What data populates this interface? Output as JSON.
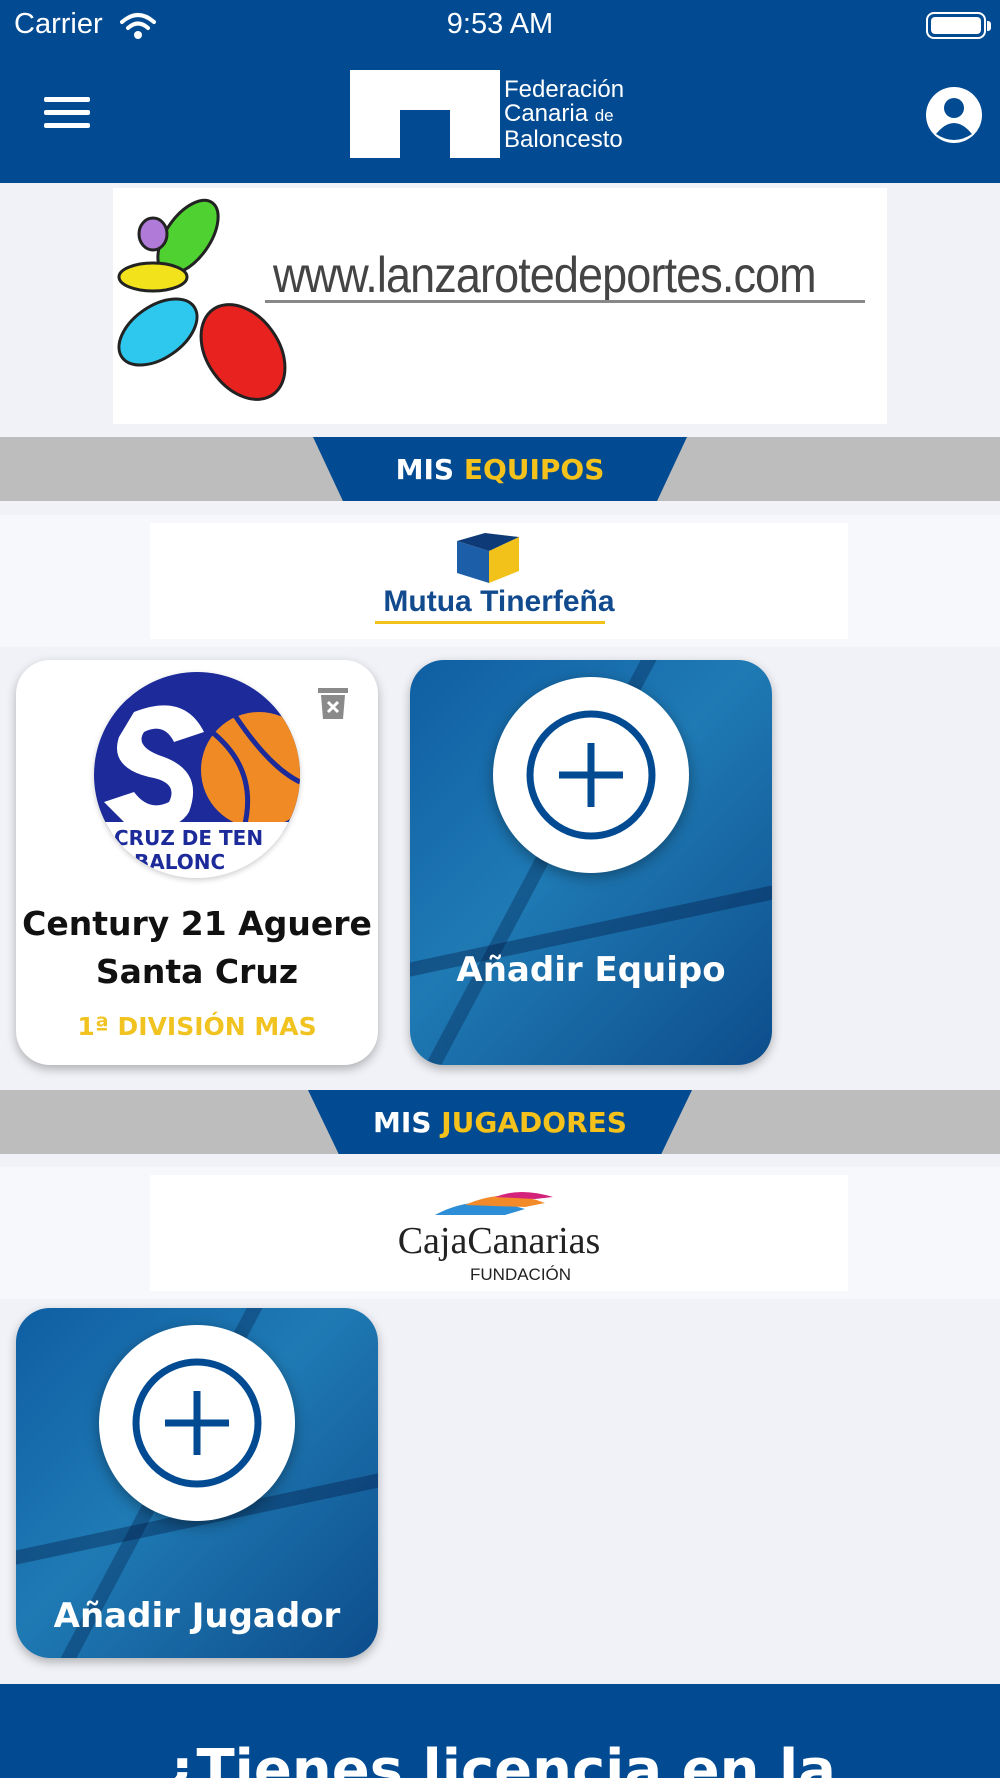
{
  "status": {
    "carrier": "Carrier",
    "time": "9:53 AM"
  },
  "header": {
    "logo_line1": "Federación",
    "logo_line2": "Canaria",
    "logo_line2_small": "de",
    "logo_line3": "Baloncesto"
  },
  "ads": {
    "top_url": "www.lanzarotedeportes.com",
    "sponsor1": "Mutua Tinerfeña",
    "sponsor2_line1": "CajaCanarias",
    "sponsor2_line2": "FUNDACIÓN"
  },
  "sections": {
    "equipos": {
      "prefix": "MIS",
      "highlight": "EQUIPOS"
    },
    "jugadores": {
      "prefix": "MIS",
      "highlight": "JUGADORES"
    }
  },
  "team_card": {
    "name_line1": "Century 21 Aguere",
    "name_line2": "Santa Cruz",
    "division": "1ª DIVISIÓN MAS",
    "crest_text1": "CRUZ DE TEN",
    "crest_text2": "BALONC"
  },
  "add_team": {
    "label": "Añadir Equipo"
  },
  "add_player": {
    "label": "Añadir Jugador"
  },
  "bottom_banner": {
    "text": "¿Tienes licencia en la"
  },
  "colors": {
    "primary": "#024b92",
    "accent": "#f4c21b",
    "section_bar": "#bdbdbd"
  }
}
